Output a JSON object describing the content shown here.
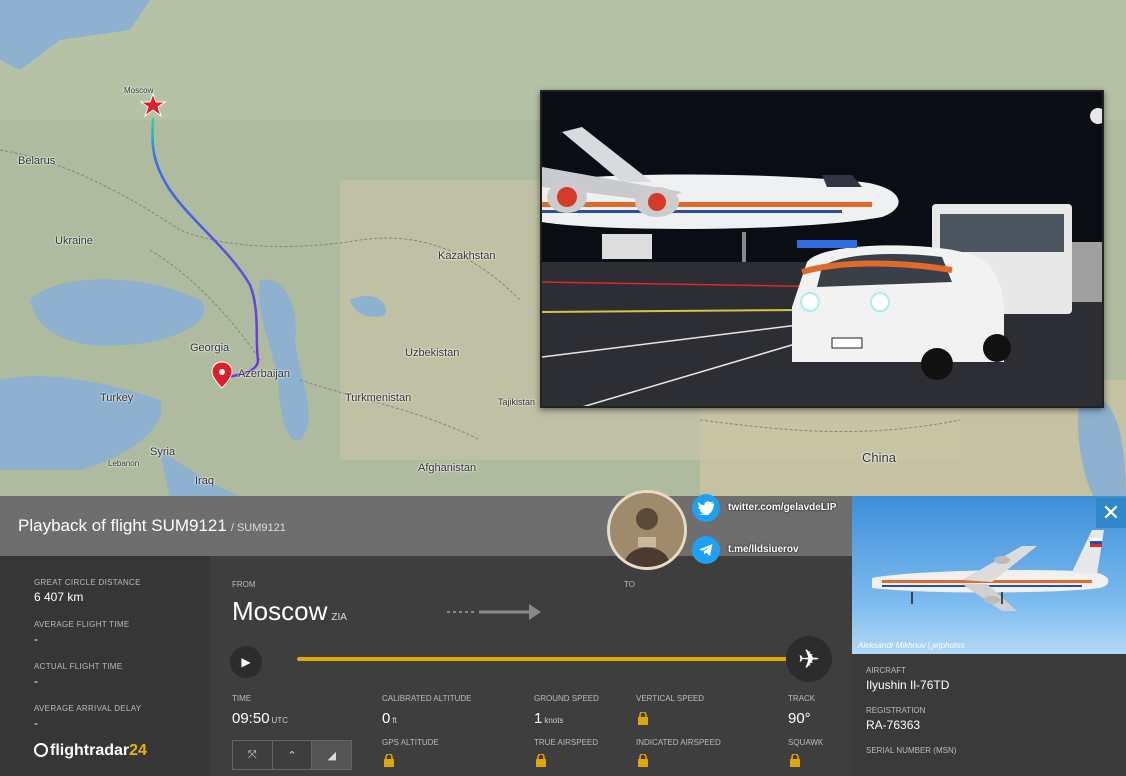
{
  "map": {
    "labels": {
      "moscow": "Moscow",
      "belarus": "Belarus",
      "ukraine": "Ukraine",
      "kazakhstan": "Kazakhstan",
      "georgia": "Georgia",
      "azerbaijan": "Azerbaijan",
      "uzbekistan": "Uzbekistan",
      "turkey": "Turkey",
      "turkmenistan": "Turkmenistan",
      "syria": "Syria",
      "iraq": "Iraq",
      "afghanistan": "Afghanistan",
      "china": "China",
      "lebanon": "Lebanon",
      "tajikistan": "Tajikistan"
    }
  },
  "flight": {
    "title": "Playback of flight SUM9121",
    "callsign": "/ SUM9121",
    "from_label": "FROM",
    "to_label": "TO",
    "origin_city": "Moscow",
    "origin_code": "ZIA"
  },
  "stats": {
    "gc_distance_label": "GREAT CIRCLE DISTANCE",
    "gc_distance_value": "6 407 km",
    "avg_flight_time_label": "AVERAGE FLIGHT TIME",
    "avg_flight_time_value": "-",
    "actual_flight_time_label": "ACTUAL FLIGHT TIME",
    "actual_flight_time_value": "-",
    "avg_arrival_delay_label": "AVERAGE ARRIVAL DELAY",
    "avg_arrival_delay_value": "-"
  },
  "brand": {
    "name": "flightradar",
    "number": "24"
  },
  "metrics": {
    "time_label": "TIME",
    "time_value": "09:50",
    "time_unit": "UTC",
    "cal_alt_label": "CALIBRATED ALTITUDE",
    "cal_alt_value": "0",
    "cal_alt_unit": "ft",
    "gps_alt_label": "GPS ALTITUDE",
    "ground_speed_label": "GROUND SPEED",
    "ground_speed_value": "1",
    "ground_speed_unit": "knots",
    "true_airspeed_label": "TRUE AIRSPEED",
    "vertical_speed_label": "VERTICAL SPEED",
    "indicated_airspeed_label": "INDICATED AIRSPEED",
    "track_label": "TRACK",
    "track_value": "90°",
    "squawk_label": "SQUAWK"
  },
  "controls": {
    "btn1": "⤧",
    "btn2": "⌃",
    "btn3": "◢"
  },
  "aircraft": {
    "credit": "Aleksandr Mikhnov | jetphotos",
    "type_label": "AIRCRAFT",
    "type_value": "Ilyushin Il-76TD",
    "reg_label": "REGISTRATION",
    "reg_value": "RA-76363",
    "serial_label": "SERIAL NUMBER (MSN)",
    "close": "✕"
  },
  "social": {
    "twitter": "twitter.com/gelavdeLIP",
    "telegram": "t.me/lldsiuerov"
  },
  "colors": {
    "route_start": "#1de0a8",
    "route_end": "#7a2fe0",
    "progress": "#e0a800",
    "origin_marker": "#e01e2a",
    "twitter": "#1da1f2"
  }
}
